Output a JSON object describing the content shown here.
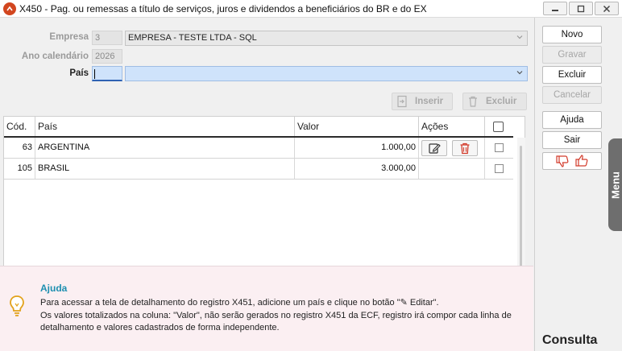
{
  "window": {
    "title": "X450 - Pag. ou remessas a título de serviços, juros e dividendos a beneficiários do BR e do EX"
  },
  "form": {
    "empresa_label": "Empresa",
    "empresa_code": "3",
    "empresa_name": "EMPRESA - TESTE LTDA - SQL",
    "ano_label": "Ano calendário",
    "ano_value": "2026",
    "pais_label": "País",
    "pais_code": "",
    "pais_name": ""
  },
  "toolbar": {
    "inserir_label": "Inserir",
    "excluir_label": "Excluir"
  },
  "grid": {
    "columns": [
      "Cód.",
      "País",
      "Valor",
      "Ações"
    ],
    "rows": [
      {
        "cod": "63",
        "pais": "ARGENTINA",
        "valor": "1.000,00"
      },
      {
        "cod": "105",
        "pais": "BRASIL",
        "valor": "3.000,00"
      }
    ]
  },
  "help": {
    "title": "Ajuda",
    "line1": "Para acessar a tela de detalhamento do registro X451, adicione um país e clique no botão \"✎ Editar\".",
    "line2": "Os valores totalizados na coluna: \"Valor\", não serão gerados no registro X451 da ECF, registro irá compor cada linha de",
    "line3": "detalhamento e valores cadastrados de forma independente."
  },
  "sidebar": {
    "novo": "Novo",
    "gravar": "Gravar",
    "excluir": "Excluir",
    "cancelar": "Cancelar",
    "ajuda": "Ajuda",
    "sair": "Sair",
    "menu_tab": "Menu",
    "mode_label": "Consulta"
  },
  "colors": {
    "accent_blue": "#cfe3fb",
    "help_title": "#1d8fb0",
    "danger_red": "#d23a2a",
    "app_icon": "#d2461f"
  }
}
